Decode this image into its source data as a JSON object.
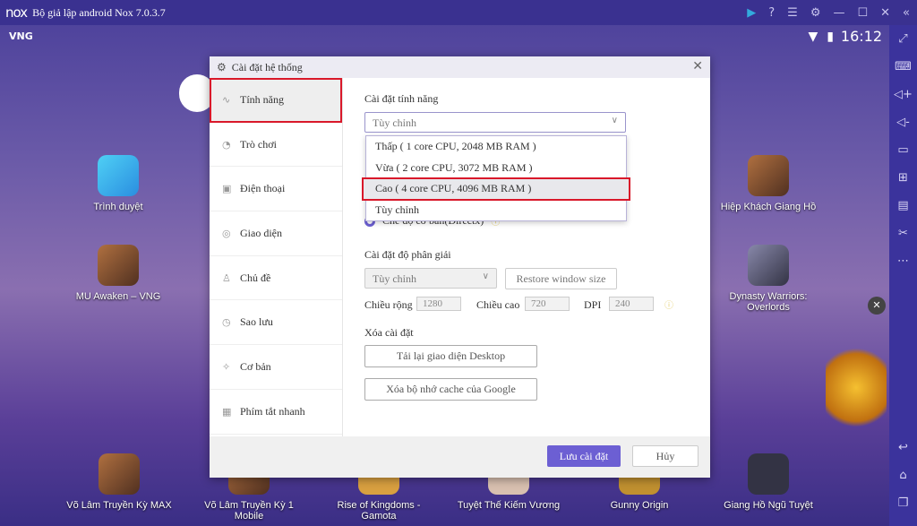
{
  "window": {
    "logo": "nox",
    "title": "Bộ giả lập android Nox 7.0.3.7",
    "icons": [
      "play-store-icon",
      "help-icon",
      "menu-icon",
      "settings-icon",
      "minimize-icon",
      "maximize-icon",
      "close-icon",
      "collapse-icon"
    ]
  },
  "status": {
    "carrier": "VNG",
    "time": "16:12"
  },
  "toolbar": [
    "fullscreen-icon",
    "keyboard-icon",
    "volume-up-icon",
    "volume-down-icon",
    "screen-icon",
    "add-apk-icon",
    "toolbox-icon",
    "screenshot-icon",
    "more-icon",
    "back-icon",
    "home-icon",
    "recent-apps-icon"
  ],
  "desktop": {
    "apps": [
      "Trình duyệt",
      "MU Awaken – VNG",
      "Hiệp Khách Giang Hồ",
      "Dynasty Warriors: Overlords"
    ],
    "dock": [
      "Võ Lâm Truyền Kỳ MAX",
      "Võ Lâm Truyền Kỳ 1 Mobile",
      "Rise of Kingdoms - Gamota",
      "Tuyệt Thế Kiếm Vương",
      "Gunny Origin",
      "Giang Hồ Ngũ Tuyệt"
    ]
  },
  "dialog": {
    "title": "Cài đặt hệ thống",
    "sidebar": [
      {
        "label": "Tính năng",
        "active": true
      },
      {
        "label": "Trò chơi"
      },
      {
        "label": "Điện thoại"
      },
      {
        "label": "Giao diện"
      },
      {
        "label": "Chủ đề"
      },
      {
        "label": "Sao lưu"
      },
      {
        "label": "Cơ bản"
      },
      {
        "label": "Phím tắt nhanh"
      }
    ],
    "perf_title": "Cài đặt tính năng",
    "perf_value": "Tùy chỉnh",
    "perf_options": [
      "Thấp ( 1 core CPU, 2048 MB RAM )",
      "Vừa ( 2 core CPU, 3072 MB RAM )",
      "Cao ( 4 core CPU, 4096 MB RAM )",
      "Tùy chỉnh"
    ],
    "render_mode": "Chế độ cơ bản(Directx)",
    "res_title": "Cài đặt độ phân giải",
    "res_value": "Tùy chỉnh",
    "restore": "Restore window size",
    "width_label": "Chiều rộng",
    "width": "1280",
    "height_label": "Chiều cao",
    "height": "720",
    "dpi_label": "DPI",
    "dpi": "240",
    "clear_title": "Xóa cài đặt",
    "reload_desktop": "Tải lại giao diện Desktop",
    "clear_cache": "Xóa bộ nhớ cache của Google",
    "save": "Lưu cài đặt",
    "cancel": "Hủy",
    "accent": "#6c5fd3"
  }
}
